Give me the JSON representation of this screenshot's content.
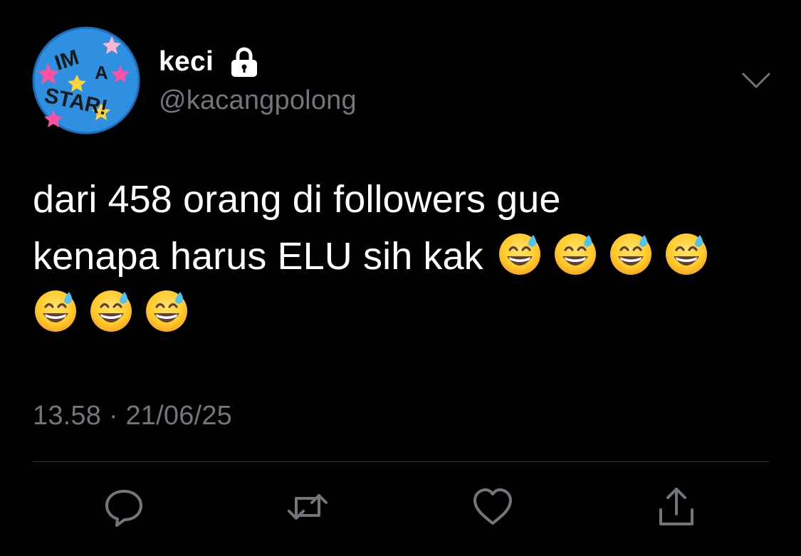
{
  "tweet": {
    "author": {
      "display_name": "keci",
      "handle": "@kacangpolong",
      "protected": true,
      "avatar_text": [
        "IM",
        "A",
        "STAR!"
      ]
    },
    "text_lines": [
      "dari 458 orang di followers gue",
      "kenapa harus ELU sih kak"
    ],
    "emoji": "grinning-face-with-sweat",
    "emoji_count": 7,
    "timestamp": "13.58 · 21/06/25"
  },
  "icons": {
    "lock": "lock-icon",
    "menu": "chevron-down-icon",
    "reply": "reply-icon",
    "retweet": "retweet-icon",
    "like": "heart-icon",
    "share": "share-icon"
  },
  "colors": {
    "background": "#000000",
    "primary_text": "#ffffff",
    "secondary_text": "#71767b",
    "divider": "#2f3336",
    "avatar_blue": "#2f8fe0"
  }
}
